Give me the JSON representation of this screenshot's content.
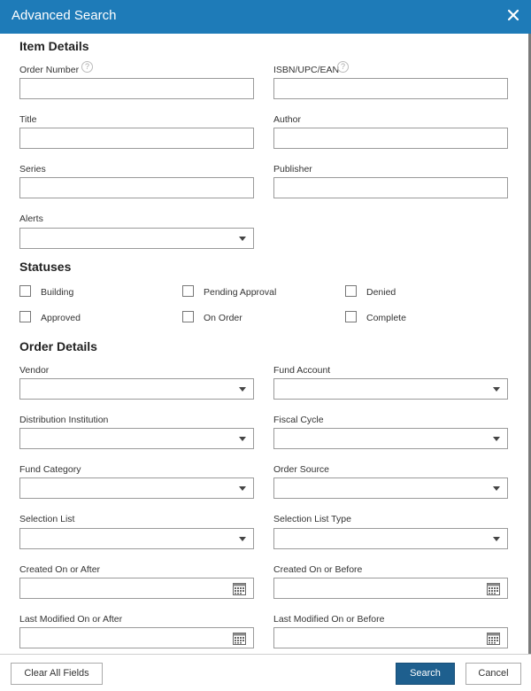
{
  "dialog": {
    "title": "Advanced Search"
  },
  "item_details": {
    "heading": "Item Details",
    "order_number_label": "Order Number",
    "isbn_label": "ISBN/UPC/EAN",
    "title_label": "Title",
    "author_label": "Author",
    "series_label": "Series",
    "publisher_label": "Publisher",
    "alerts_label": "Alerts",
    "help_glyph": "?"
  },
  "statuses": {
    "heading": "Statuses",
    "building": "Building",
    "pending_approval": "Pending Approval",
    "denied": "Denied",
    "approved": "Approved",
    "on_order": "On Order",
    "complete": "Complete"
  },
  "order_details": {
    "heading": "Order Details",
    "vendor_label": "Vendor",
    "fund_account_label": "Fund Account",
    "distribution_institution_label": "Distribution Institution",
    "fiscal_cycle_label": "Fiscal Cycle",
    "fund_category_label": "Fund Category",
    "order_source_label": "Order Source",
    "selection_list_label": "Selection List",
    "selection_list_type_label": "Selection List Type",
    "created_after_label": "Created On or After",
    "created_before_label": "Created On or Before",
    "modified_after_label": "Last Modified On or After",
    "modified_before_label": "Last Modified On or Before"
  },
  "footer": {
    "clear_label": "Clear All Fields",
    "search_label": "Search",
    "cancel_label": "Cancel"
  },
  "colors": {
    "header": "#1e7bb8",
    "primary_button": "#1e5f8e"
  }
}
